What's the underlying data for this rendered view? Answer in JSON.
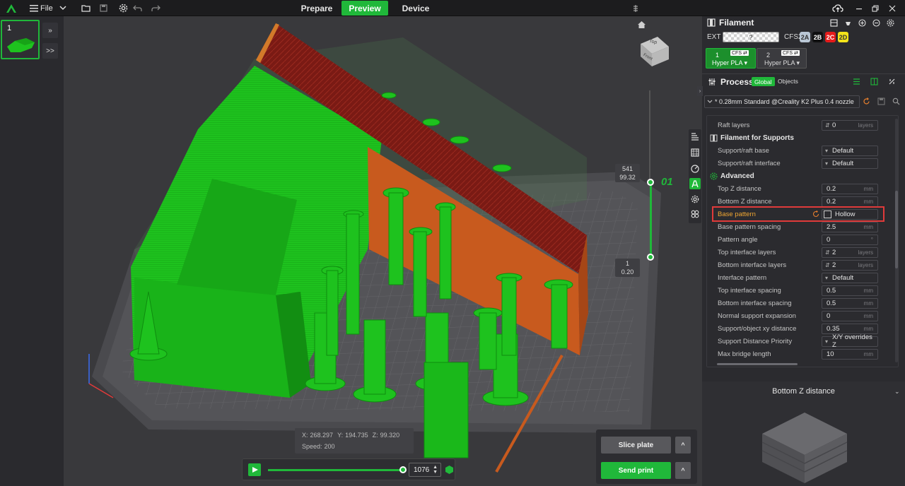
{
  "topbar": {
    "file_label": "File",
    "tabs": [
      {
        "label": "Prepare",
        "active": false
      },
      {
        "label": "Preview",
        "active": true
      },
      {
        "label": "Device",
        "active": false
      }
    ]
  },
  "plates": {
    "thumb_index": "1",
    "expand_label": "»",
    "expand2_label": ">>"
  },
  "viewport": {
    "layer_top": "541",
    "layer_top_z": "99.32",
    "layer_bottom": "1",
    "layer_bottom_z": "0.20",
    "layer_label": "01",
    "cube_top": "Top",
    "cube_front": "Front",
    "coords": {
      "x_label": "X:",
      "x": "268.297",
      "y_label": "Y:",
      "y": "194.735",
      "z_label": "Z:",
      "z": "99.320"
    },
    "speed_label": "Speed:",
    "speed": "200",
    "move_value": "1076"
  },
  "actions": {
    "slice_plate": "Slice plate",
    "send_print": "Send print"
  },
  "filament": {
    "title": "Filament",
    "ext_label": "EXT",
    "ext_value": "?",
    "cfs_label": "CFS2",
    "slots": [
      {
        "label": "2A",
        "bg": "#b9c6d4",
        "fg": "#333"
      },
      {
        "label": "2B",
        "bg": "#0f0f10",
        "fg": "#fff"
      },
      {
        "label": "2C",
        "bg": "#e51b1b",
        "fg": "#fff"
      },
      {
        "label": "2D",
        "bg": "#f2e21a",
        "fg": "#333"
      }
    ],
    "trays": [
      {
        "num": "1",
        "badge": "CFS ⇄",
        "name": "Hyper PLA ▾",
        "active": true
      },
      {
        "num": "2",
        "badge": "CFS ⇄",
        "name": "Hyper PLA ▾",
        "active": false
      }
    ]
  },
  "process": {
    "title": "Process",
    "global_label": "Global",
    "objects_label": "Objects",
    "preset": "* 0.28mm Standard @Creality K2 Plus 0.4 nozzle"
  },
  "settings": {
    "raft_layers": {
      "label": "Raft layers",
      "value": "0",
      "unit": "layers"
    },
    "filament_for_supports": "Filament for Supports",
    "support_raft_base": {
      "label": "Support/raft base",
      "value": "Default"
    },
    "support_raft_interface": {
      "label": "Support/raft interface",
      "value": "Default"
    },
    "advanced": "Advanced",
    "top_z_distance": {
      "label": "Top Z distance",
      "value": "0.2",
      "unit": "mm"
    },
    "bottom_z_distance": {
      "label": "Bottom Z distance",
      "value": "0.2",
      "unit": "mm"
    },
    "base_pattern": {
      "label": "Base pattern",
      "value": "Hollow"
    },
    "base_pattern_spacing": {
      "label": "Base pattern spacing",
      "value": "2.5",
      "unit": "mm"
    },
    "pattern_angle": {
      "label": "Pattern angle",
      "value": "0",
      "unit": "°"
    },
    "top_interface_layers": {
      "label": "Top interface layers",
      "value": "2",
      "unit": "layers"
    },
    "bottom_interface_layers": {
      "label": "Bottom interface layers",
      "value": "2",
      "unit": "layers"
    },
    "interface_pattern": {
      "label": "Interface pattern",
      "value": "Default"
    },
    "top_interface_spacing": {
      "label": "Top interface spacing",
      "value": "0.5",
      "unit": "mm"
    },
    "bottom_interface_spacing": {
      "label": "Bottom interface spacing",
      "value": "0.5",
      "unit": "mm"
    },
    "normal_support_expansion": {
      "label": "Normal support expansion",
      "value": "0",
      "unit": "mm"
    },
    "support_object_xy_distance": {
      "label": "Support/object xy distance",
      "value": "0.35",
      "unit": "mm"
    },
    "support_distance_priority": {
      "label": "Support Distance Priority",
      "value": "X/Y overrides Z"
    },
    "max_bridge_length": {
      "label": "Max bridge length",
      "value": "10",
      "unit": "mm"
    }
  },
  "preview": {
    "title": "Bottom Z distance"
  },
  "colors": {
    "accent_green": "#20b83a",
    "highlight_red": "#e03a3a",
    "model_green": "#1ec21e",
    "support_orange": "#c85a1e",
    "support_dark_red": "#7a1a14"
  }
}
